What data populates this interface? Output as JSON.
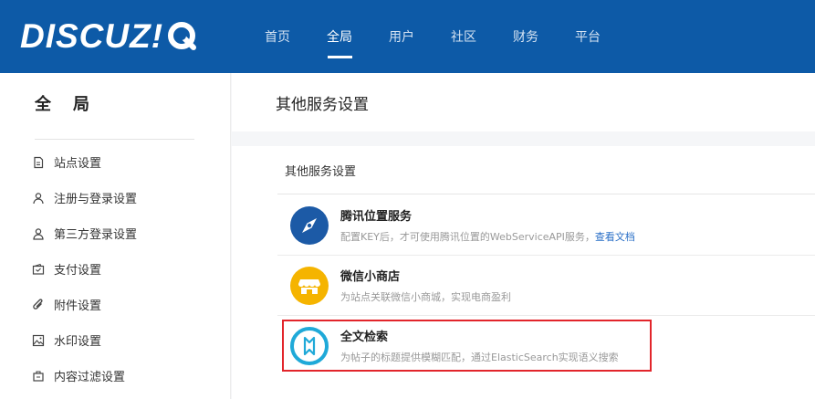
{
  "header": {
    "logo_text": "DISCUZ!",
    "nav": [
      {
        "label": "首页"
      },
      {
        "label": "全局"
      },
      {
        "label": "用户"
      },
      {
        "label": "社区"
      },
      {
        "label": "财务"
      },
      {
        "label": "平台"
      }
    ],
    "active_index": 1
  },
  "sidebar": {
    "title": "全局",
    "items": [
      {
        "label": "站点设置",
        "icon": "document-icon"
      },
      {
        "label": "注册与登录设置",
        "icon": "user-icon"
      },
      {
        "label": "第三方登录设置",
        "icon": "user-outline-icon"
      },
      {
        "label": "支付设置",
        "icon": "wallet-icon"
      },
      {
        "label": "附件设置",
        "icon": "paperclip-icon"
      },
      {
        "label": "水印设置",
        "icon": "image-icon"
      },
      {
        "label": "内容过滤设置",
        "icon": "filter-icon"
      }
    ]
  },
  "main": {
    "page_title": "其他服务设置",
    "section_title": "其他服务设置",
    "services": [
      {
        "name": "腾讯位置服务",
        "desc": "配置KEY后，才可使用腾讯位置的WebServiceAPI服务，",
        "link": "查看文档",
        "icon": "compass-icon",
        "color": "#1c5aa6"
      },
      {
        "name": "微信小商店",
        "desc": "为站点关联微信小商城，实现电商盈利",
        "link": "",
        "icon": "shop-icon",
        "color": "#f5b400"
      },
      {
        "name": "全文检索",
        "desc": "为帖子的标题提供模糊匹配，通过ElasticSearch实现语义搜索",
        "link": "",
        "icon": "search-bolt-icon",
        "color": "#1fa9d8"
      }
    ]
  },
  "colors": {
    "header_bg": "#0d5aa7",
    "highlight": "#e2252b"
  }
}
